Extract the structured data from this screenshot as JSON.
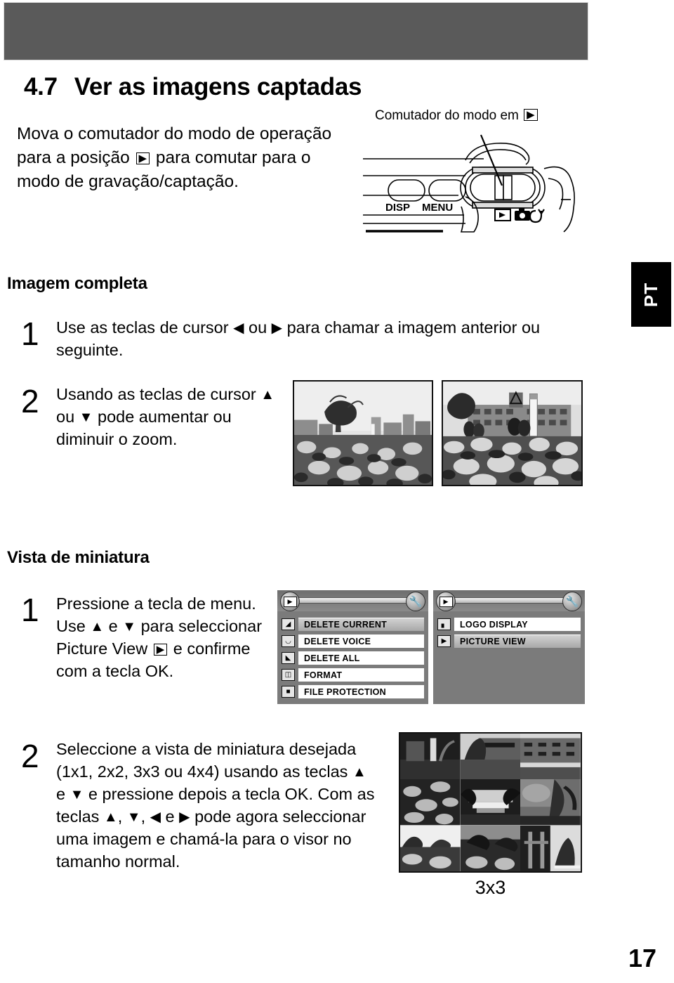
{
  "page": {
    "number": "17",
    "language_tab": "PT"
  },
  "section": {
    "number": "4.7",
    "title": "Ver as imagens captadas",
    "intro": "Mova o comutador do modo de operação para a posição ▶ para comutar para o modo de gravação/captação."
  },
  "camera_figure": {
    "caption": "Comutador do modo em",
    "caption_icon": "play-icon",
    "button_labels": [
      "DISP",
      "MENU"
    ],
    "mode_icons": [
      "play-icon",
      "camera-icon",
      "movie-icon"
    ]
  },
  "full_image_section": {
    "heading": "Imagem completa",
    "steps": [
      {
        "number": "1",
        "text": "Use as teclas de cursor ◀ ou ▶ para chamar a imagem anterior ou seguinte."
      },
      {
        "number": "2",
        "text": "Usando as teclas de cursor ▲ ou ▼ pode aumentar ou diminuir o zoom."
      }
    ],
    "photos": [
      {
        "name": "photo-wide",
        "alt": "Praça urbana com flores, vista normal"
      },
      {
        "name": "photo-zoom",
        "alt": "Praça urbana com flores, vista ampliada"
      }
    ]
  },
  "thumbnail_section": {
    "heading": "Vista de miniatura",
    "steps": [
      {
        "number": "1",
        "text": "Pressione a tecla de menu. Use ▲ e ▼ para seleccionar Picture View ▶ e confirme com a tecla OK."
      },
      {
        "number": "2",
        "text": "Seleccione a vista de miniatura desejada (1x1, 2x2, 3x3 ou 4x4) usando as teclas ▲ e ▼ e pressione depois a tecla OK. Com as teclas ▲, ▼, ◀ e ▶ pode agora seleccionar uma imagem e chamá-la para o visor no tamanho normal."
      }
    ],
    "grid_label": "3x3"
  },
  "menus": {
    "left": {
      "tab_left_icon": "play-icon",
      "tab_right_icon": "wrench-icon",
      "items": [
        {
          "label": "DELETE CURRENT",
          "icon": "trash-current-icon",
          "selected": true
        },
        {
          "label": "DELETE VOICE",
          "icon": "trash-voice-icon",
          "selected": false
        },
        {
          "label": "DELETE ALL",
          "icon": "trash-all-icon",
          "selected": false
        },
        {
          "label": "FORMAT",
          "icon": "trash-icon",
          "selected": false
        },
        {
          "label": "FILE PROTECTION",
          "icon": "briefcase-lock-icon",
          "selected": false
        }
      ]
    },
    "right": {
      "tab_left_icon": "play-icon",
      "tab_right_icon": "wrench-icon",
      "items": [
        {
          "label": "LOGO DISPLAY",
          "icon": "logo-icon",
          "selected": false
        },
        {
          "label": "PICTURE VIEW",
          "icon": "play-icon",
          "selected": true
        }
      ]
    }
  },
  "colors": {
    "banner": "#5a5a5a",
    "menu_background": "#7b7b7b",
    "menu_item": "#ffffff",
    "menu_item_selected": "#bdbdbd",
    "tab_black": "#000000"
  }
}
